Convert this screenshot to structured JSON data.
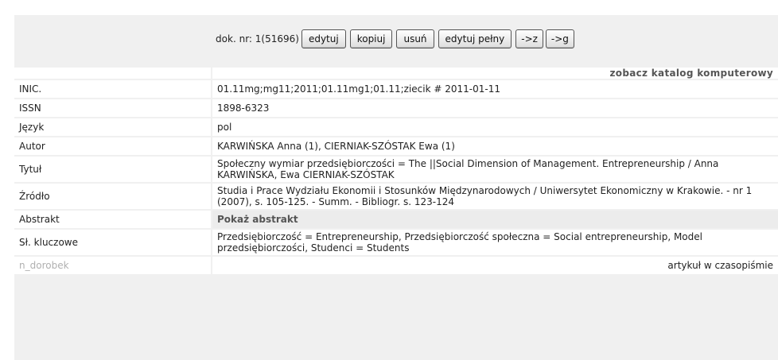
{
  "toolbar": {
    "doc_label": "dok. nr: 1(51696)",
    "buttons": {
      "edit": "edytuj",
      "copy": "kopiuj",
      "delete": "usuń",
      "edit_full": "edytuj pełny",
      "to_z": "->z",
      "to_g": "->g"
    }
  },
  "record": {
    "catalog_link": "zobacz katalog komputerowy",
    "rows": [
      {
        "label": "INIC.",
        "value": "01.11mg;mg11;2011;01.11mg1;01.11;ziecik # 2011-01-11"
      },
      {
        "label": "ISSN",
        "value": "1898-6323"
      },
      {
        "label": "Język",
        "value": "pol"
      },
      {
        "label": "Autor",
        "value": "KARWIŃSKA Anna (1), CIERNIAK-SZÓSTAK Ewa (1)"
      },
      {
        "label": "Tytuł",
        "value": "Społeczny wymiar przedsiębiorczości = The ||Social Dimension of Management. Entrepreneurship / Anna KARWIŃSKA, Ewa CIERNIAK-SZÓSTAK"
      },
      {
        "label": "Źródło",
        "value": "Studia i Prace Wydziału Ekonomii i Stosunków Międzynarodowych / Uniwersytet Ekonomiczny w Krakowie. - nr 1 (2007), s. 105-125. - Summ. - Bibliogr. s. 123-124"
      },
      {
        "label": "Abstrakt",
        "value": "Pokaż abstrakt"
      },
      {
        "label": "Sł. kluczowe",
        "value": "Przedsiębiorczość = Entrepreneurship, Przedsiębiorczość społeczna = Social entrepreneurship, Model przedsiębiorczości, Studenci = Students"
      },
      {
        "label": "n_dorobek",
        "value": "artykuł w czasopiśmie"
      }
    ]
  }
}
